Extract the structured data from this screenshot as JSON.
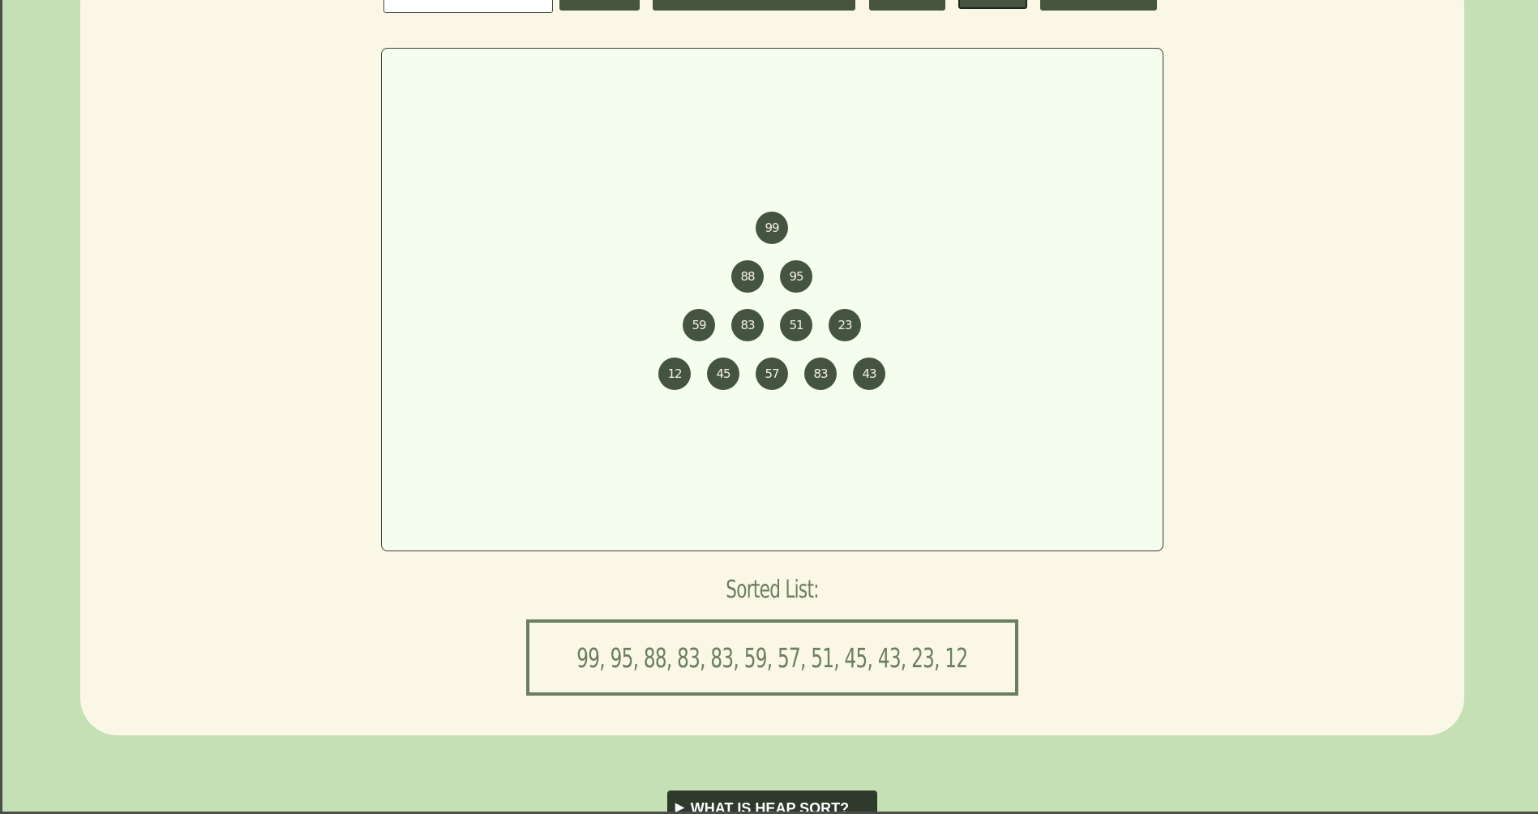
{
  "toolbar": {
    "input_value": "",
    "buttons": [
      "",
      "",
      "",
      "",
      ""
    ]
  },
  "heap": {
    "nodes": [
      99,
      88,
      95,
      59,
      83,
      51,
      23,
      12,
      45,
      57,
      83,
      43
    ]
  },
  "sorted": {
    "title": "Sorted List:",
    "values": "99, 95, 88, 83, 83, 59, 57, 51, 45, 43, 23, 12"
  },
  "help": {
    "label": "WHAT IS HEAP SORT?",
    "marker": "▶"
  },
  "colors": {
    "page_bg": "#c5e0b4",
    "panel_bg": "#faf7e6",
    "node_bg": "#455441",
    "accent": "#6b7e60"
  }
}
